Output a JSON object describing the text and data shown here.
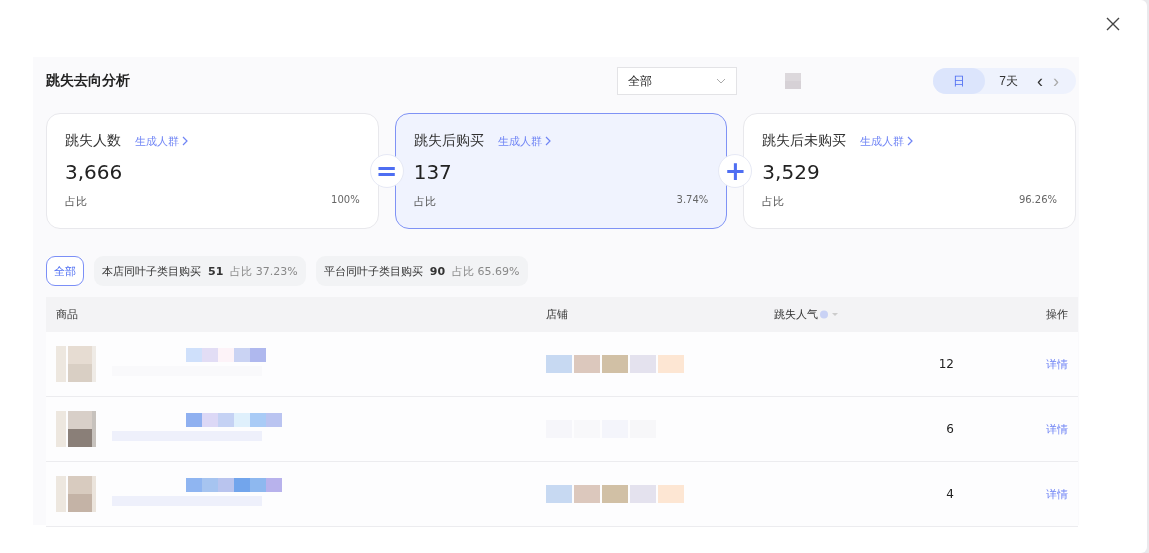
{
  "title": "跳失去向分析",
  "toolbar": {
    "dropdown": {
      "value": "全部"
    },
    "period_tabs": [
      {
        "label": "日",
        "selected": true
      },
      {
        "label": "7天",
        "selected": false
      }
    ],
    "prev": "‹",
    "next": "›"
  },
  "cards": [
    {
      "title": "跳失人数",
      "link": "生成人群",
      "value": "3,666",
      "share_label": "占比",
      "share": "100%",
      "selected": false
    },
    {
      "operator": "=",
      "title": "跳失后购买",
      "link": "生成人群",
      "value": "137",
      "share_label": "占比",
      "share": "3.74%",
      "selected": true
    },
    {
      "operator": "+",
      "title": "跳失后未购买",
      "link": "生成人群",
      "value": "3,529",
      "share_label": "占比",
      "share": "96.26%",
      "selected": false
    }
  ],
  "filters": [
    {
      "label": "全部",
      "selected": true
    },
    {
      "label": "本店同叶子类目购买",
      "count": "51",
      "share": "占比 37.23%",
      "selected": false
    },
    {
      "label": "平台同叶子类目购买",
      "count": "90",
      "share": "占比 65.69%",
      "selected": false
    }
  ],
  "table": {
    "columns": [
      "商品",
      "店铺",
      "跳失人气",
      "操作"
    ],
    "rows": [
      {
        "count": "12",
        "action": "详情"
      },
      {
        "count": "6",
        "action": "详情"
      },
      {
        "count": "4",
        "action": "详情"
      }
    ]
  }
}
